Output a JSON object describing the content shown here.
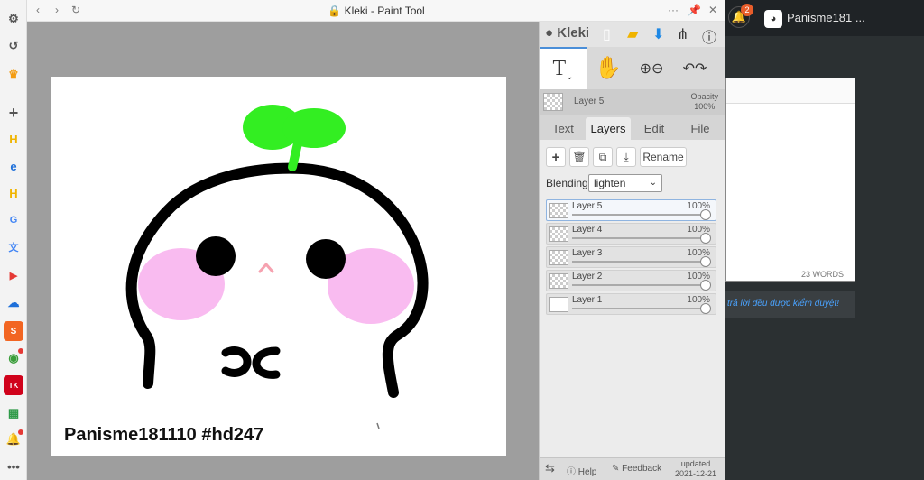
{
  "window": {
    "title": "Kleki - Paint Tool"
  },
  "canvas": {
    "caption": "Panisme181110 #hd247"
  },
  "panel": {
    "logo": "Kleki",
    "layer_header": {
      "name": "Layer 5",
      "opacity_label": "Opacity",
      "opacity_value": "100%"
    },
    "tabs": [
      "Text",
      "Layers",
      "Edit",
      "File"
    ],
    "active_tab": "Layers",
    "rename_label": "Rename",
    "blending_label": "Blending",
    "blending_value": "lighten",
    "layers": [
      {
        "name": "Layer 5",
        "opacity": "100%",
        "selected": true
      },
      {
        "name": "Layer 4",
        "opacity": "100%",
        "selected": false
      },
      {
        "name": "Layer 3",
        "opacity": "100%",
        "selected": false
      },
      {
        "name": "Layer 2",
        "opacity": "100%",
        "selected": false
      },
      {
        "name": "Layer 1",
        "opacity": "100%",
        "selected": false
      }
    ],
    "bottom": {
      "help_label": "Help",
      "feedback_label": "Feedback",
      "updated_label": "updated",
      "updated_date": "2021-12-21"
    }
  },
  "page_right": {
    "notification_count": "2",
    "user_name": "Panisme181 ...",
    "word_count": "23 WORDS",
    "notice": "trả lời đều được kiểm duyệt!"
  },
  "colors": {
    "accent": "#4a8ed8",
    "sprout": "#33ee22",
    "blush": "#f8b4ee"
  }
}
